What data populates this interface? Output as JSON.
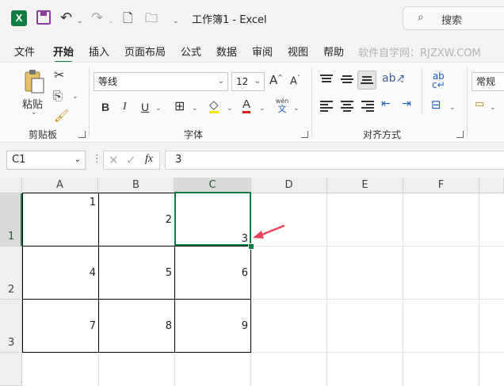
{
  "titlebar": {
    "app_icon": "excel-icon",
    "window_title": "工作簿1  -  Excel",
    "search_label": "搜索"
  },
  "menu": {
    "tabs": [
      "文件",
      "开始",
      "插入",
      "页面布局",
      "公式",
      "数据",
      "审阅",
      "视图",
      "帮助"
    ],
    "active_tab": "开始",
    "watermark": "软件自学网：RJZXW.COM"
  },
  "ribbon": {
    "clipboard": {
      "group_label": "剪贴板",
      "paste_label": "粘贴"
    },
    "font": {
      "group_label": "字体",
      "font_name": "等线",
      "font_size": "12",
      "phonetic_top": "wén",
      "phonetic_bottom": "文"
    },
    "alignment": {
      "group_label": "对齐方式"
    },
    "number": {
      "format": "常规"
    }
  },
  "formula_bar": {
    "name_box": "C1",
    "fx_label": "fx",
    "formula_value": "3"
  },
  "sheet": {
    "columns": [
      "A",
      "B",
      "C",
      "D",
      "E",
      "F"
    ],
    "rows": [
      "1",
      "2",
      "3"
    ],
    "selected_cell": "C1",
    "cells": {
      "A1": "1",
      "B1": "2",
      "C1": "3",
      "A2": "4",
      "B2": "5",
      "C2": "6",
      "A3": "7",
      "B3": "8",
      "C3": "9"
    }
  },
  "colors": {
    "accent": "#107c41",
    "arrow": "#e8455b"
  }
}
